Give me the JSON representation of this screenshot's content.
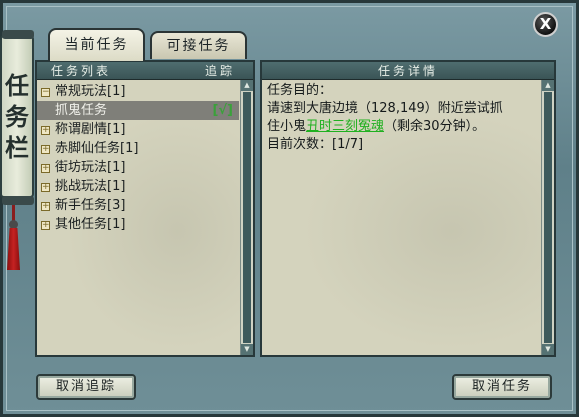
{
  "window": {
    "side_label": [
      "任",
      "务",
      "栏"
    ],
    "close_label": "X"
  },
  "tabs": [
    {
      "label": "当前任务",
      "active": true
    },
    {
      "label": "可接任务",
      "active": false
    }
  ],
  "task_list": {
    "header_title": "任务列表",
    "header_track": "追踪",
    "items": [
      {
        "label": "常规玩法[1]",
        "toggle": "⊟",
        "expanded": true
      },
      {
        "label": "抓鬼任务",
        "child": true,
        "selected": true,
        "track_mark": "[√]"
      },
      {
        "label": "称谓剧情[1]",
        "toggle": "⊞"
      },
      {
        "label": "赤脚仙任务[1]",
        "toggle": "⊞"
      },
      {
        "label": "街坊玩法[1]",
        "toggle": "⊞"
      },
      {
        "label": "挑战玩法[1]",
        "toggle": "⊞"
      },
      {
        "label": "新手任务[3]",
        "toggle": "⊞"
      },
      {
        "label": "其他任务[1]",
        "toggle": "⊞"
      }
    ]
  },
  "task_detail": {
    "header_title": "任务详情",
    "goal_label": "任务目的：",
    "line1": "请速到大唐边境（128,149）附近尝试抓",
    "line2_prefix": "住小鬼",
    "npc_name": "丑时三刻冤魂",
    "line2_suffix": "（剩余30分钟）。",
    "progress": "目前次数：[1/7]"
  },
  "buttons": {
    "untrack": "取消追踪",
    "cancel_task": "取消任务"
  },
  "colors": {
    "frame": "#6f8f97",
    "panel_header": "#3a5456",
    "panel_bg": "#d4d3bd",
    "selected_row": "#7f7f79",
    "track_mark": "#3aa13a",
    "npc_link": "#20b020",
    "tassel": "#c52222"
  }
}
